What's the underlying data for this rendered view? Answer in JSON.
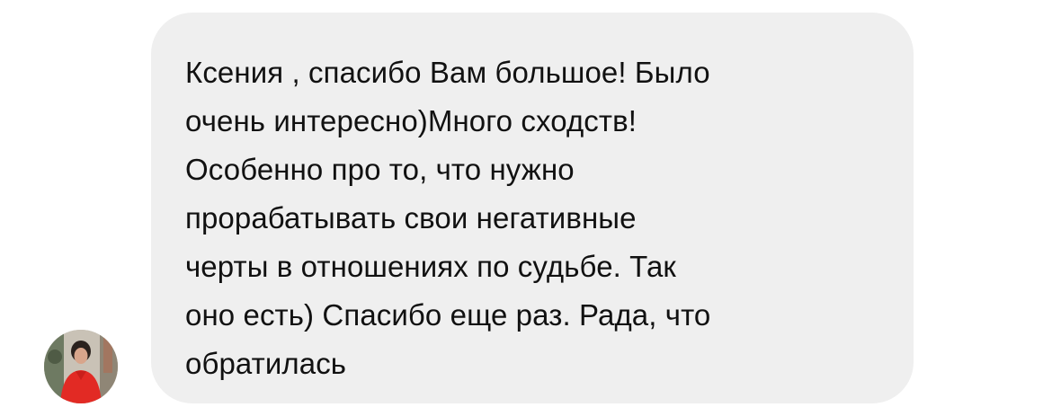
{
  "conversation": {
    "message": {
      "sender_avatar": "user-avatar-photo",
      "text": "Ксения , спасибо Вам большое! Было\nочень интересно)Много сходств!\nОсобенно про то, что нужно\nпрорабатывать свои негативные\nчерты в отношениях по судьбе. Так\nоно есть) Спасибо еще раз. Рада, что\nобратилась",
      "bubble_color": "#efefef",
      "text_color": "#111111"
    }
  }
}
